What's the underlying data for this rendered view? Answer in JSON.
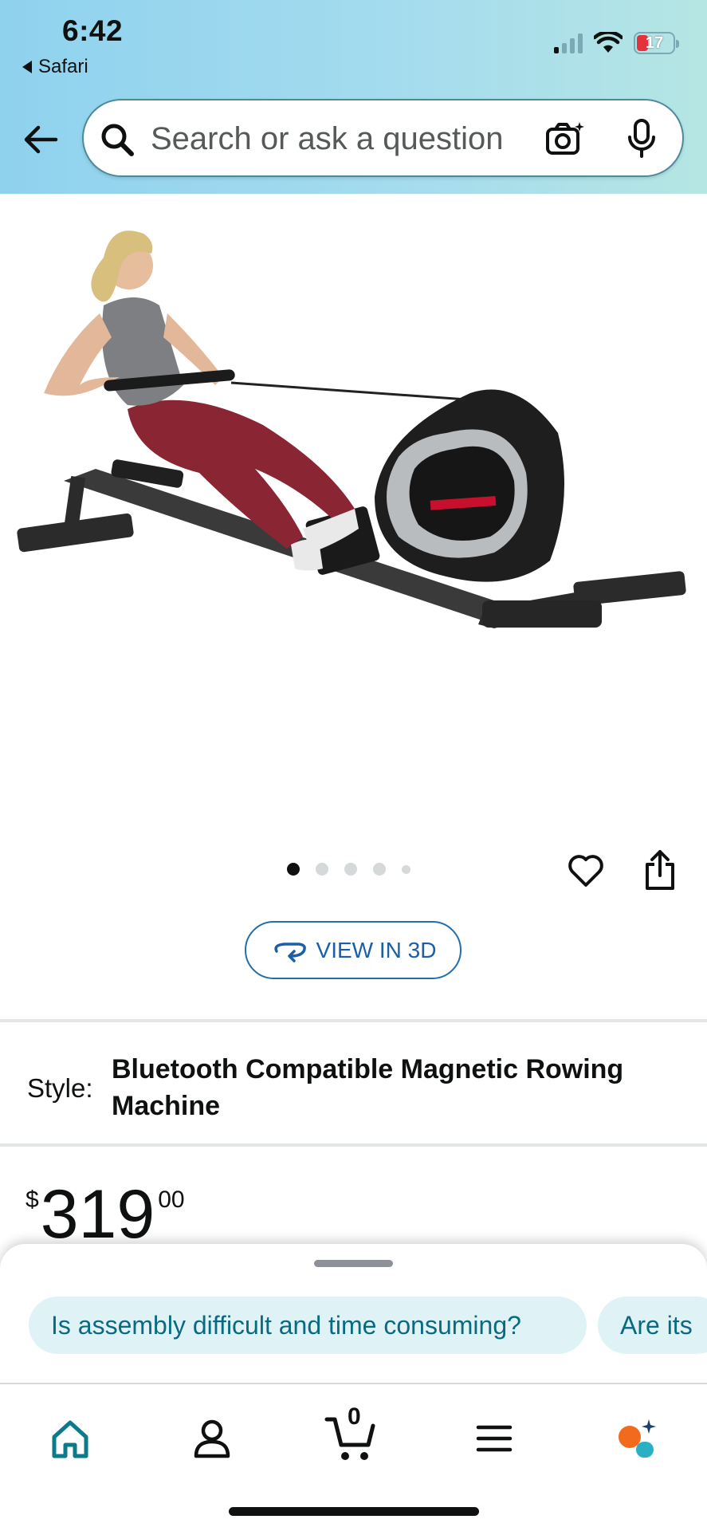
{
  "status_bar": {
    "time": "6:42",
    "back_app": "Safari",
    "battery_level": "17"
  },
  "search": {
    "placeholder": "Search or ask a question"
  },
  "icons": {
    "back": "back-arrow-icon",
    "search": "search-icon",
    "camera": "camera-icon",
    "mic": "microphone-icon",
    "heart": "heart-icon",
    "share": "share-icon"
  },
  "carousel": {
    "total": 5,
    "active_index": 0
  },
  "view_3d": {
    "label": "VIEW IN 3D"
  },
  "product": {
    "style_label": "Style:",
    "style_value": "Bluetooth Compatible Magnetic Rowing Machine",
    "price_currency": "$",
    "price_whole": "319",
    "price_fraction": "00"
  },
  "questions": [
    "Is assembly difficult and time consuming?",
    "Are its"
  ],
  "tabbar": {
    "cart_count": "0",
    "items": [
      "home-icon",
      "account-icon",
      "cart-icon",
      "menu-icon",
      "rufus-icon"
    ]
  },
  "colors": {
    "header_gradient_start": "#8fd2ee",
    "accent_teal": "#0b6a80",
    "link_blue": "#1a5fa8",
    "chip_bg": "#dff3f7"
  }
}
